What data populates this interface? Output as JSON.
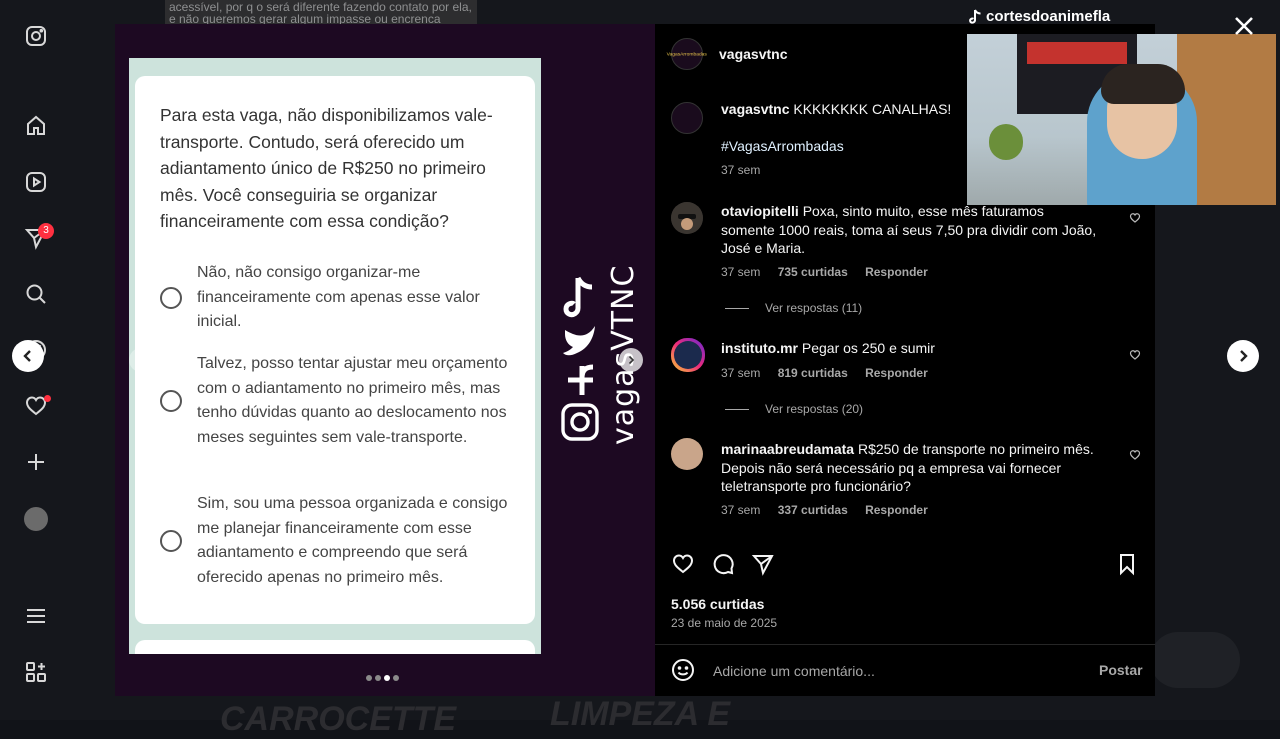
{
  "background": {
    "top_snippet_lines": [
      "acessível, por q o será diferente fazendo contato por ela,",
      "e não queremos gerar algum impasse ou encrenca"
    ],
    "bottom_texts": [
      "CARROCETTE",
      "LIMPEZA E"
    ]
  },
  "rail": {
    "notification_count": "3",
    "icons": [
      "instagram-logo-icon",
      "home-icon",
      "reels-icon",
      "messages-icon",
      "search-icon",
      "explore-icon",
      "notifications-icon",
      "create-icon",
      "profile-icon",
      "more-icon",
      "also-from-meta-icon"
    ]
  },
  "post": {
    "author": "vagasvtnc",
    "caption_text": "KKKKKKKK CANALHAS!",
    "hashtag": "#VagasArrombadas",
    "caption_age": "37 sem",
    "avatar_badge": "VagasArrombadas",
    "likes": "5.056 curtidas",
    "date": "23 de maio de 2025",
    "comment_placeholder": "Adicione um comentário...",
    "post_label": "Postar"
  },
  "quiz": {
    "question": "Para esta vaga, não disponibilizamos vale-transporte. Contudo, será oferecido um adiantamento único de R$250 no primeiro mês. Você conseguiria se organizar financeiramente com essa condição?",
    "options": [
      "Não, não consigo organizar-me financeiramente com apenas esse valor inicial.",
      "Talvez, posso tentar ajustar meu orçamento com o adiantamento no primeiro mês, mas tenho dúvidas quanto ao deslocamento nos meses seguintes sem vale-transporte.",
      "Sim, sou uma pessoa organizada e consigo me planejar financeiramente com esse adiantamento e compreendo que será oferecido apenas no primeiro mês."
    ]
  },
  "brand": {
    "text": "vagasVTNC"
  },
  "comments": [
    {
      "user": "otaviopitelli",
      "text": "Poxa, sinto muito, esse mês faturamos somente 1000 reais, toma aí seus 7,50 pra dividir com João, José e Maria.",
      "age": "37 sem",
      "likes": "735 curtidas",
      "reply": "Responder",
      "view_replies": "Ver respostas (11)"
    },
    {
      "user": "instituto.mr",
      "text": "Pegar os 250 e sumir",
      "age": "37 sem",
      "likes": "819 curtidas",
      "reply": "Responder",
      "view_replies": "Ver respostas (20)"
    },
    {
      "user": "marinaabreudamata",
      "text": "R$250 de transporte no primeiro mês. Depois não será necessário pq a empresa vai fornecer teletransporte pro funcionário?",
      "age": "37 sem",
      "likes": "337 curtidas",
      "reply": "Responder"
    }
  ],
  "overlay": {
    "tiktok_handle": "cortesdoanimefla"
  },
  "carousel": {
    "total_slides": 4,
    "active_slide": 3
  },
  "colors": {
    "accent_red": "#ff3040",
    "panel_bg": "#000000",
    "media_bg": "#1d0922",
    "hashtag": "#e0f1ff"
  }
}
